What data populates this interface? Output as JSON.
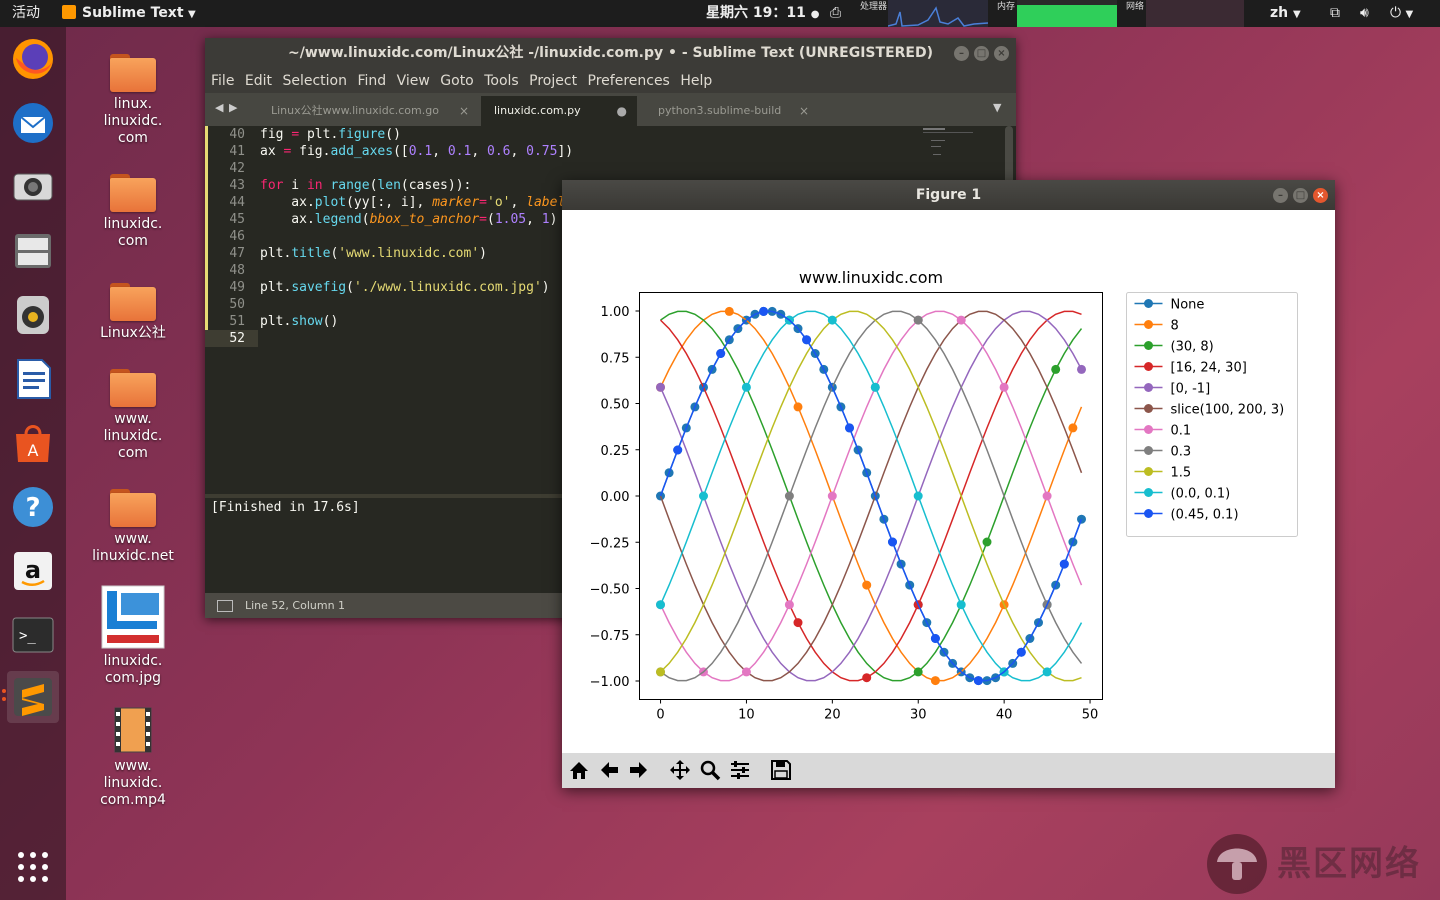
{
  "topbar": {
    "activities": "活动",
    "app_name": "Sublime Text",
    "clock": "星期六 19：11",
    "cpu_label": "处理器",
    "mem_label": "内存",
    "net_label": "网络",
    "lang": "zh"
  },
  "desktop": [
    {
      "label": "linux.\nlinuxidc.\ncom",
      "l1": "linux.",
      "l2": "linuxidc.",
      "l3": "com"
    },
    {
      "l1": "linuxidc.",
      "l2": "com"
    },
    {
      "l1": "Linux公社"
    },
    {
      "l1": "www.",
      "l2": "linuxidc.",
      "l3": "com"
    },
    {
      "l1": "www.",
      "l2": "linuxidc.net"
    },
    {
      "l1": "linuxidc.",
      "l2": "com.jpg"
    },
    {
      "l1": "www.",
      "l2": "linuxidc.",
      "l3": "com.mp4"
    }
  ],
  "sublime": {
    "title": "~/www.linuxidc.com/Linux公社 -/linuxidc.com.py • - Sublime Text (UNREGISTERED)",
    "menu": [
      "File",
      "Edit",
      "Selection",
      "Find",
      "View",
      "Goto",
      "Tools",
      "Project",
      "Preferences",
      "Help"
    ],
    "tabs": [
      {
        "label": "Linux公社www.linuxidc.com.go",
        "close": "×"
      },
      {
        "label": "linuxidc.com.py",
        "close": "●"
      },
      {
        "label": "python3.sublime-build",
        "close": "×"
      }
    ],
    "console_text": "[Finished in 17.6s]",
    "status": "Line 52, Column 1",
    "line_numbers": [
      "40",
      "41",
      "42",
      "43",
      "44",
      "45",
      "46",
      "47",
      "48",
      "49",
      "50",
      "51",
      "52"
    ]
  },
  "figure": {
    "title": "Figure 1"
  },
  "chart_data": {
    "type": "line",
    "title": "www.linuxidc.com",
    "xlabel": "",
    "ylabel": "",
    "xlim": [
      -2.45,
      51.45
    ],
    "ylim": [
      -1.1,
      1.1
    ],
    "x_ticks": [
      0,
      10,
      20,
      30,
      40,
      50
    ],
    "y_ticks": [
      -1.0,
      -0.75,
      -0.5,
      -0.25,
      0.0,
      0.25,
      0.5,
      0.75,
      1.0
    ],
    "y_tick_labels": [
      "−1.00",
      "−0.75",
      "−0.50",
      "−0.25",
      "0.00",
      "0.25",
      "0.50",
      "0.75",
      "1.00"
    ],
    "x_tick_labels": [
      "0",
      "10",
      "20",
      "30",
      "40",
      "50"
    ],
    "x_values": "0 to 49 step 1",
    "series_formula": "y = sin(2*pi*x/50 + i*pi/5), i = 0..9",
    "marker": "o",
    "legend_placement": "outside-upper-right",
    "series": [
      {
        "name": "None",
        "color": "#1f77b4",
        "phase_index": 0,
        "markevery": "None"
      },
      {
        "name": "8",
        "color": "#ff7f0e",
        "phase_index": 1,
        "markevery": "8"
      },
      {
        "name": "(30, 8)",
        "color": "#2ca02c",
        "phase_index": 2,
        "markevery": "(30, 8)"
      },
      {
        "name": "[16, 24, 30]",
        "color": "#d62728",
        "phase_index": 3,
        "markevery": "[16, 24, 30]"
      },
      {
        "name": "[0, -1]",
        "color": "#9467bd",
        "phase_index": 4,
        "markevery": "[0, -1]"
      },
      {
        "name": "slice(100, 200, 3)",
        "color": "#8c564b",
        "phase_index": 5,
        "markevery": "slice(100, 200, 3)"
      },
      {
        "name": "0.1",
        "color": "#e377c2",
        "phase_index": 6,
        "markevery": "0.1"
      },
      {
        "name": "0.3",
        "color": "#7f7f7f",
        "phase_index": 7,
        "markevery": "0.3"
      },
      {
        "name": "1.5",
        "color": "#bcbd22",
        "phase_index": 8,
        "markevery": "1.5"
      },
      {
        "name": "(0.0, 0.1)",
        "color": "#17becf",
        "phase_index": 9,
        "markevery": "(0.0, 0.1)"
      },
      {
        "name": "(0.45, 0.1)",
        "color": "#1a55f2",
        "phase_index": 10,
        "markevery": "(0.45, 0.1)"
      }
    ]
  },
  "watermark": {
    "text": "黑区网络"
  }
}
